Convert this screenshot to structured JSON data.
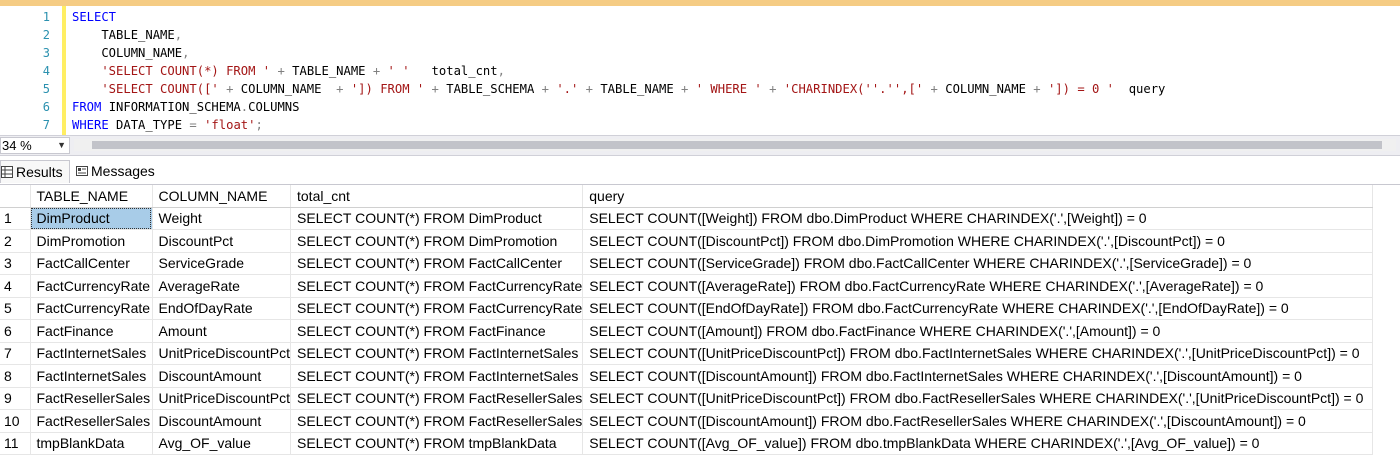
{
  "editor": {
    "line_numbers": [
      "1",
      "2",
      "3",
      "4",
      "5",
      "6",
      "7"
    ],
    "lines": [
      [
        {
          "t": "SELECT",
          "c": "kw"
        }
      ],
      [
        {
          "t": "    TABLE_NAME",
          "c": "id"
        },
        {
          "t": ",",
          "c": "op"
        }
      ],
      [
        {
          "t": "    COLUMN_NAME",
          "c": "id"
        },
        {
          "t": ",",
          "c": "op"
        }
      ],
      [
        {
          "t": "    'SELECT COUNT(*) FROM '",
          "c": "str"
        },
        {
          "t": " + ",
          "c": "op"
        },
        {
          "t": "TABLE_NAME",
          "c": "id"
        },
        {
          "t": " + ",
          "c": "op"
        },
        {
          "t": "' '",
          "c": "str"
        },
        {
          "t": "   total_cnt",
          "c": "id"
        },
        {
          "t": ",",
          "c": "op"
        }
      ],
      [
        {
          "t": "    'SELECT COUNT(['",
          "c": "str"
        },
        {
          "t": " + ",
          "c": "op"
        },
        {
          "t": "COLUMN_NAME",
          "c": "id"
        },
        {
          "t": "  + ",
          "c": "op"
        },
        {
          "t": "']) FROM '",
          "c": "str"
        },
        {
          "t": " + ",
          "c": "op"
        },
        {
          "t": "TABLE_SCHEMA",
          "c": "id"
        },
        {
          "t": " + ",
          "c": "op"
        },
        {
          "t": "'.'",
          "c": "str"
        },
        {
          "t": " + ",
          "c": "op"
        },
        {
          "t": "TABLE_NAME",
          "c": "id"
        },
        {
          "t": " + ",
          "c": "op"
        },
        {
          "t": "' WHERE '",
          "c": "str"
        },
        {
          "t": " + ",
          "c": "op"
        },
        {
          "t": "'CHARINDEX(''.'',['",
          "c": "str"
        },
        {
          "t": " + ",
          "c": "op"
        },
        {
          "t": "COLUMN_NAME",
          "c": "id"
        },
        {
          "t": " + ",
          "c": "op"
        },
        {
          "t": "']) = 0 '",
          "c": "str"
        },
        {
          "t": "  query",
          "c": "id"
        }
      ],
      [
        {
          "t": "FROM ",
          "c": "kw"
        },
        {
          "t": "INFORMATION_SCHEMA",
          "c": "id"
        },
        {
          "t": ".",
          "c": "op"
        },
        {
          "t": "COLUMNS",
          "c": "id"
        }
      ],
      [
        {
          "t": "WHERE ",
          "c": "kw"
        },
        {
          "t": "DATA_TYPE",
          "c": "id"
        },
        {
          "t": " = ",
          "c": "op"
        },
        {
          "t": "'float'",
          "c": "str"
        },
        {
          "t": ";",
          "c": "op"
        }
      ]
    ]
  },
  "zoom": {
    "value": "34 %"
  },
  "tabs": {
    "results": "Results",
    "messages": "Messages"
  },
  "grid": {
    "columns": [
      "TABLE_NAME",
      "COLUMN_NAME",
      "total_cnt",
      "query"
    ],
    "rows": [
      {
        "n": "1",
        "cells": [
          "DimProduct",
          "Weight",
          "SELECT COUNT(*) FROM DimProduct",
          "SELECT COUNT([Weight]) FROM dbo.DimProduct WHERE CHARINDEX('.',[Weight]) = 0"
        ]
      },
      {
        "n": "2",
        "cells": [
          "DimPromotion",
          "DiscountPct",
          "SELECT COUNT(*) FROM DimPromotion",
          "SELECT COUNT([DiscountPct]) FROM dbo.DimPromotion WHERE CHARINDEX('.',[DiscountPct]) = 0"
        ]
      },
      {
        "n": "3",
        "cells": [
          "FactCallCenter",
          "ServiceGrade",
          "SELECT COUNT(*) FROM FactCallCenter",
          "SELECT COUNT([ServiceGrade]) FROM dbo.FactCallCenter WHERE CHARINDEX('.',[ServiceGrade]) = 0"
        ]
      },
      {
        "n": "4",
        "cells": [
          "FactCurrencyRate",
          "AverageRate",
          "SELECT COUNT(*) FROM FactCurrencyRate",
          "SELECT COUNT([AverageRate]) FROM dbo.FactCurrencyRate WHERE CHARINDEX('.',[AverageRate]) = 0"
        ]
      },
      {
        "n": "5",
        "cells": [
          "FactCurrencyRate",
          "EndOfDayRate",
          "SELECT COUNT(*) FROM FactCurrencyRate",
          "SELECT COUNT([EndOfDayRate]) FROM dbo.FactCurrencyRate WHERE CHARINDEX('.',[EndOfDayRate]) = 0"
        ]
      },
      {
        "n": "6",
        "cells": [
          "FactFinance",
          "Amount",
          "SELECT COUNT(*) FROM FactFinance",
          "SELECT COUNT([Amount]) FROM dbo.FactFinance WHERE CHARINDEX('.',[Amount]) = 0"
        ]
      },
      {
        "n": "7",
        "cells": [
          "FactInternetSales",
          "UnitPriceDiscountPct",
          "SELECT COUNT(*) FROM FactInternetSales",
          "SELECT COUNT([UnitPriceDiscountPct]) FROM dbo.FactInternetSales WHERE CHARINDEX('.',[UnitPriceDiscountPct]) = 0"
        ]
      },
      {
        "n": "8",
        "cells": [
          "FactInternetSales",
          "DiscountAmount",
          "SELECT COUNT(*) FROM FactInternetSales",
          "SELECT COUNT([DiscountAmount]) FROM dbo.FactInternetSales WHERE CHARINDEX('.',[DiscountAmount]) = 0"
        ]
      },
      {
        "n": "9",
        "cells": [
          "FactResellerSales",
          "UnitPriceDiscountPct",
          "SELECT COUNT(*) FROM FactResellerSales",
          "SELECT COUNT([UnitPriceDiscountPct]) FROM dbo.FactResellerSales WHERE CHARINDEX('.',[UnitPriceDiscountPct]) = 0"
        ]
      },
      {
        "n": "10",
        "cells": [
          "FactResellerSales",
          "DiscountAmount",
          "SELECT COUNT(*) FROM FactResellerSales",
          "SELECT COUNT([DiscountAmount]) FROM dbo.FactResellerSales WHERE CHARINDEX('.',[DiscountAmount]) = 0"
        ]
      },
      {
        "n": "11",
        "cells": [
          "tmpBlankData",
          "Avg_OF_value",
          "SELECT COUNT(*) FROM tmpBlankData",
          "SELECT COUNT([Avg_OF_value]) FROM dbo.tmpBlankData WHERE CHARINDEX('.',[Avg_OF_value]) = 0"
        ]
      }
    ]
  },
  "colors": {
    "keyword": "#0000ff",
    "string": "#a31515",
    "operator": "#808080",
    "line_number": "#2b91af",
    "change_bar": "#ffee62",
    "selected_cell": "#a8cce8"
  }
}
